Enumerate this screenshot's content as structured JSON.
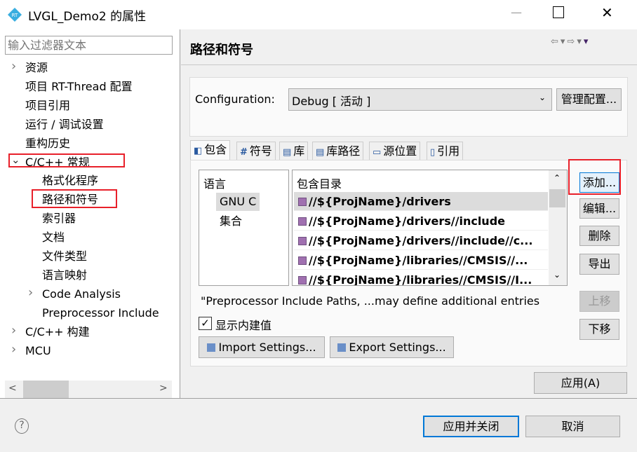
{
  "window": {
    "title": "LVGL_Demo2 的属性",
    "logo_text": "RT",
    "minimize": "—",
    "maximize": "☐",
    "close": "✕"
  },
  "sidebar": {
    "filter_placeholder": "输入过滤器文本",
    "items": [
      {
        "label": "资源",
        "expandable": true
      },
      {
        "label": "项目 RT-Thread 配置"
      },
      {
        "label": "项目引用"
      },
      {
        "label": "运行 / 调试设置"
      },
      {
        "label": "重构历史"
      },
      {
        "label": "C/C++ 常规",
        "expanded": true,
        "highlighted": true
      },
      {
        "label": "格式化程序"
      },
      {
        "label": "路径和符号",
        "selected": true,
        "highlighted": true
      },
      {
        "label": "索引器"
      },
      {
        "label": "文档"
      },
      {
        "label": "文件类型"
      },
      {
        "label": "语言映射"
      },
      {
        "label": "Code Analysis",
        "expandable": true
      },
      {
        "label": "Preprocessor Include"
      },
      {
        "label": "C/C++ 构建",
        "expandable": true
      },
      {
        "label": "MCU",
        "expandable": true
      }
    ]
  },
  "main": {
    "page_title": "路径和符号",
    "configuration_label": "Configuration:",
    "configuration_value": "Debug  [ 活动 ]",
    "manage_button": "管理配置...",
    "tabs": [
      {
        "label": "包含",
        "icon": "include-icon",
        "active": true
      },
      {
        "label": "符号",
        "icon": "hash-icon"
      },
      {
        "label": "库",
        "icon": "library-icon"
      },
      {
        "label": "库路径",
        "icon": "library-path-icon"
      },
      {
        "label": "源位置",
        "icon": "source-folder-icon"
      },
      {
        "label": "引用",
        "icon": "reference-icon"
      }
    ],
    "languages_header": "语言",
    "languages": [
      "GNU C",
      "集合"
    ],
    "includes_header": "包含目录",
    "includes": [
      "//${ProjName}/drivers",
      "//${ProjName}/drivers//include",
      "//${ProjName}/drivers//include//c...",
      "//${ProjName}/libraries//CMSIS//...",
      "//${ProjName}/libraries//CMSIS//I..."
    ],
    "buttons": {
      "add": "添加...",
      "edit": "编辑...",
      "delete": "删除",
      "export": "导出",
      "move_up": "上移",
      "move_down": "下移"
    },
    "note": "\"Preprocessor Include Paths, ...may define additional entries",
    "show_builtin_label": "显示内建值",
    "show_builtin_checked": true,
    "import_settings": "Import Settings...",
    "export_settings": "Export Settings...",
    "apply": "应用(A)"
  },
  "footer": {
    "help": "?",
    "apply_close": "应用并关闭",
    "cancel": "取消"
  },
  "colors": {
    "highlight_box": "#e8202a",
    "primary_button_border": "#0078d7"
  }
}
